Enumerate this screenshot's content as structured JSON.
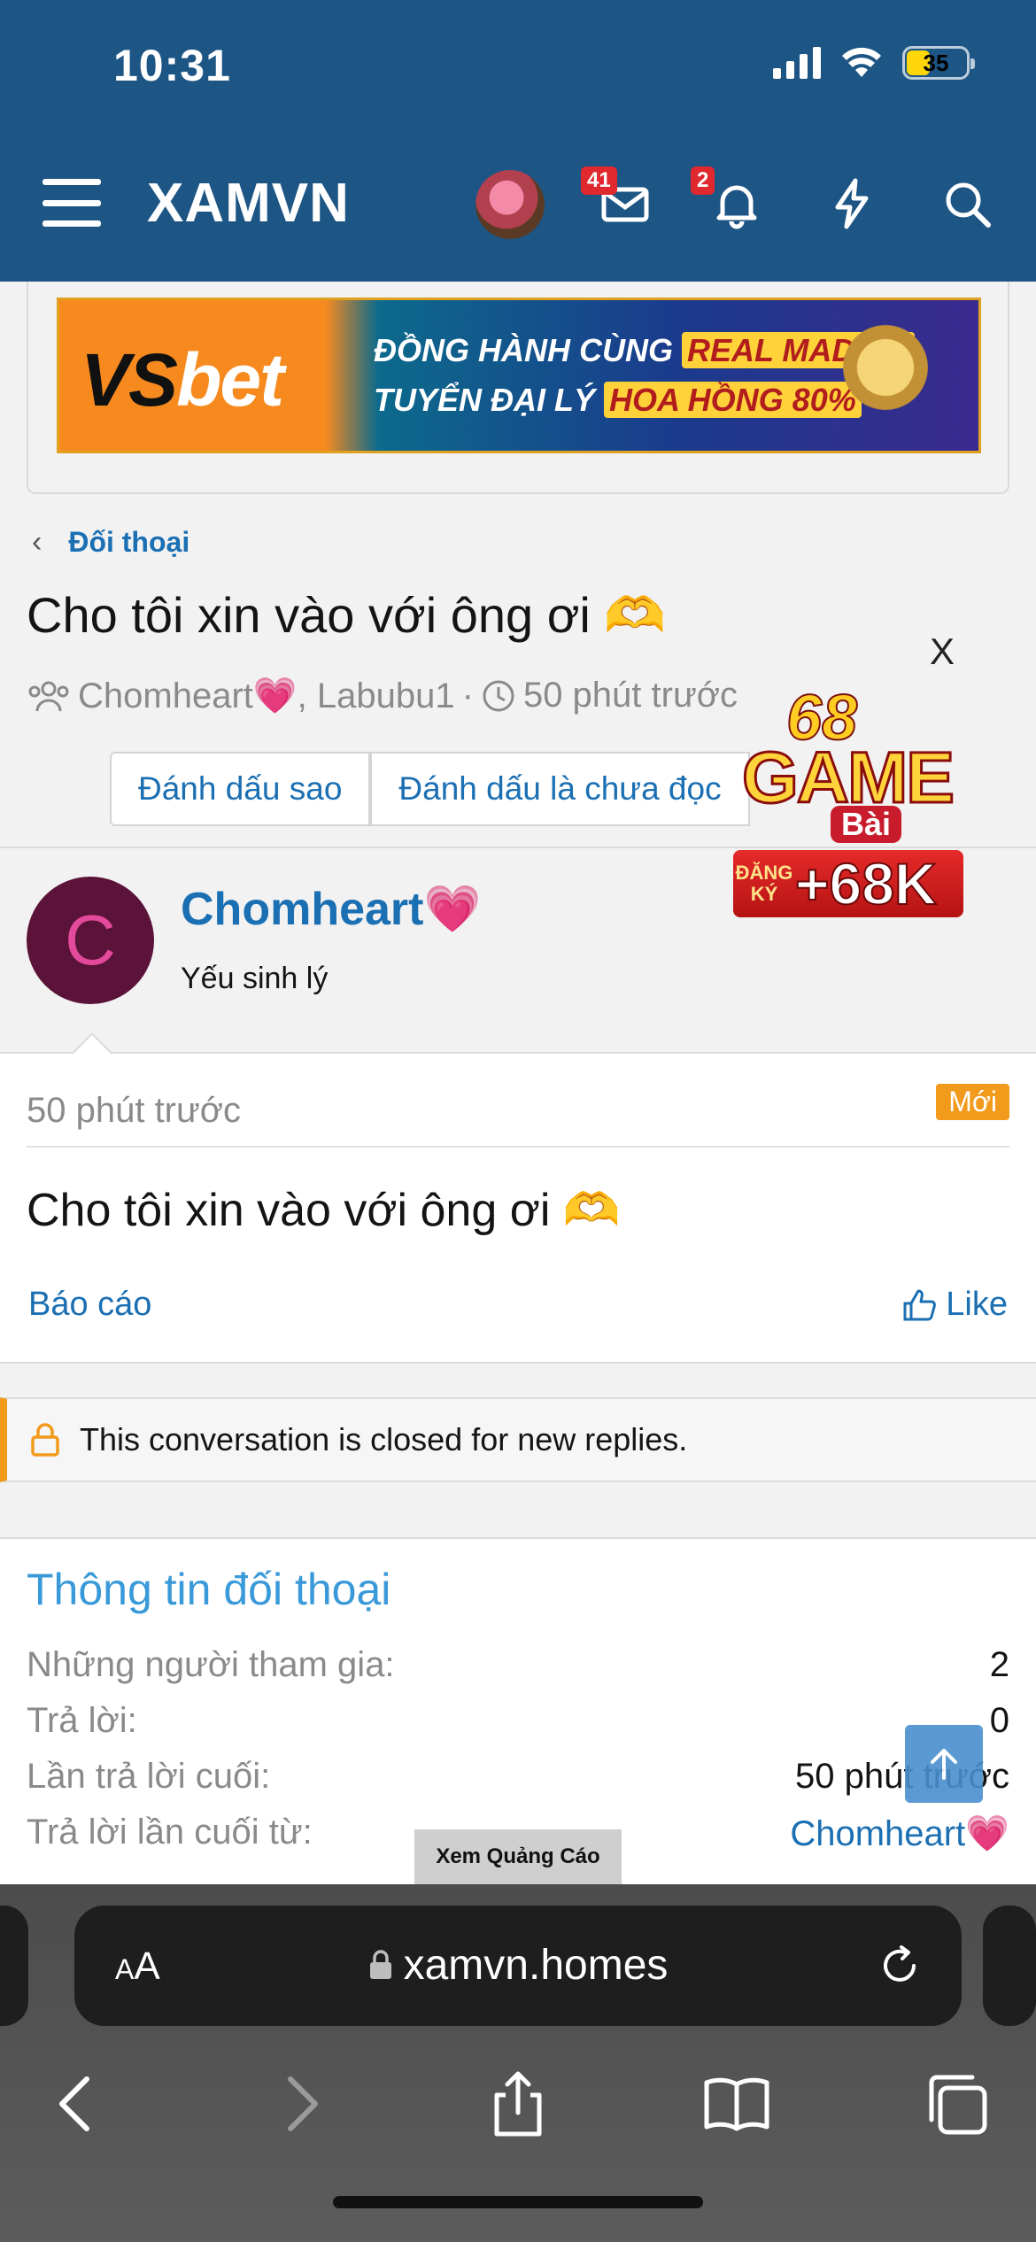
{
  "status": {
    "time": "10:31",
    "battery": "35"
  },
  "nav": {
    "brand": "XAMVN",
    "messages_badge": "41",
    "alerts_badge": "2"
  },
  "ad": {
    "logo_vs": "VS",
    "logo_bet": "bet",
    "line1_a": "ĐỒNG HÀNH CÙNG ",
    "line1_hl": "REAL MADRID",
    "line2_a": "TUYỂN ĐẠI LÝ ",
    "line2_hl": "HOA HỒNG 80%"
  },
  "breadcrumb": {
    "label": "Đối thoại"
  },
  "page": {
    "title": "Cho tôi xin vào với ông ơi 🫶",
    "meta_participants": "Chomheart💗, Labubu1",
    "meta_separator": "·",
    "meta_time": "50 phút trước"
  },
  "actions": {
    "star": "Đánh dấu sao",
    "unread": "Đánh dấu là chưa đọc"
  },
  "float_ad": {
    "close": "X",
    "num": "68",
    "word": "GAME",
    "bai": "Bài",
    "reg_small": "ĐĂNG KÝ",
    "reg_big": "+68K"
  },
  "post": {
    "avatar_letter": "C",
    "author": "Chomheart💗",
    "author_title": "Yếu sinh lý",
    "time": "50 phút trước",
    "badge": "Mới",
    "body": "Cho tôi xin vào với ông ơi 🫶",
    "report": "Báo cáo",
    "like": "Like"
  },
  "closed_notice": "This conversation is closed for new replies.",
  "info": {
    "title": "Thông tin đối thoại",
    "rows": [
      {
        "label": "Những người tham gia:",
        "value": "2"
      },
      {
        "label": "Trả lời:",
        "value": "0"
      },
      {
        "label": "Lần trả lời cuối:",
        "value": "50 phút trước"
      },
      {
        "label": "Trả lời lần cuối từ:",
        "value": "Chomheart💗"
      }
    ]
  },
  "view_ad": "Xem Quảng Cáo",
  "browser": {
    "aa_small": "A",
    "aa_big": "A",
    "url": "xamvn.homes"
  },
  "colors": {
    "header": "#1d5585",
    "link": "#1b6fb3",
    "accent": "#f29a1c"
  }
}
